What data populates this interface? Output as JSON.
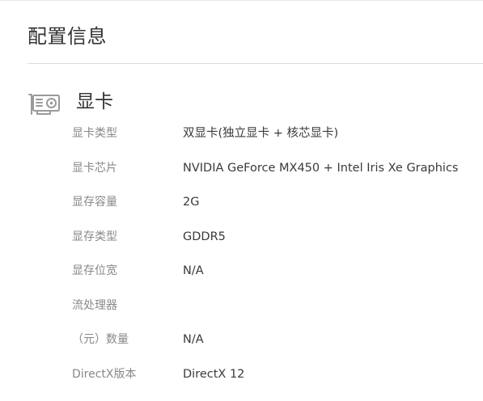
{
  "page": {
    "title": "配置信息"
  },
  "section": {
    "icon": "graphics-card-icon",
    "title": "显卡"
  },
  "specs": [
    {
      "label": "显卡类型",
      "value": "双显卡(独立显卡 + 核芯显卡)"
    },
    {
      "label": "显卡芯片",
      "value": "NVIDIA GeForce MX450 + Intel Iris Xe Graphics"
    },
    {
      "label": "显存容量",
      "value": "2G"
    },
    {
      "label": "显存类型",
      "value": "GDDR5"
    },
    {
      "label": "显存位宽",
      "value": "N/A"
    },
    {
      "label": "流处理器",
      "value": ""
    },
    {
      "label": "（元）数量",
      "value": "N/A"
    },
    {
      "label": "DirectX版本",
      "value": "DirectX 12"
    }
  ],
  "colors": {
    "text_primary": "#333333",
    "text_label": "#888888",
    "icon": "#9a9a9a",
    "divider": "#dcdcdc"
  }
}
